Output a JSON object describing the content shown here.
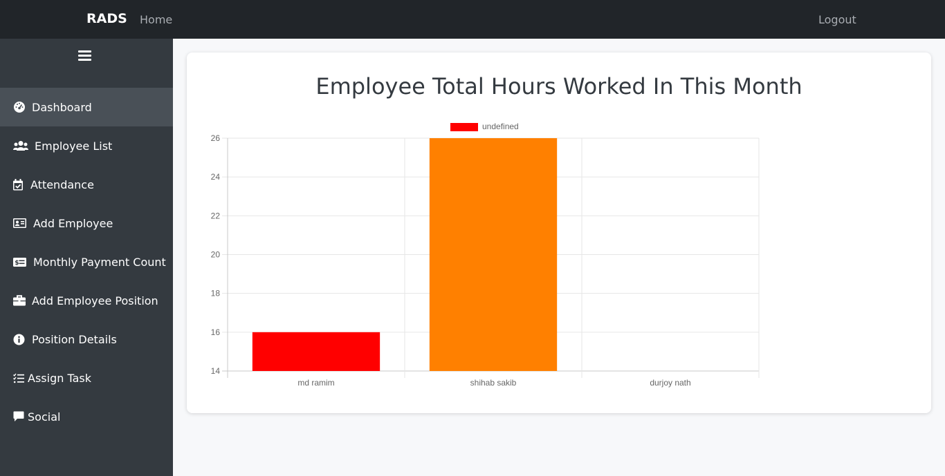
{
  "navbar": {
    "brand": "RADS",
    "home": "Home",
    "logout": "Logout"
  },
  "sidebar": {
    "items": [
      {
        "label": "Dashboard",
        "icon": "dashboard-icon",
        "active": true
      },
      {
        "label": "Employee List",
        "icon": "users-icon"
      },
      {
        "label": "Attendance",
        "icon": "calendar-check-icon"
      },
      {
        "label": "Add Employee",
        "icon": "id-card-icon"
      },
      {
        "label": "Monthly Payment Count",
        "icon": "money-bill-icon"
      },
      {
        "label": "Add Employee Position",
        "icon": "briefcase-icon"
      },
      {
        "label": "Position Details",
        "icon": "info-circle-icon"
      },
      {
        "label": "Assign Task",
        "icon": "task-list-icon"
      },
      {
        "label": "Social",
        "icon": "comment-icon"
      }
    ]
  },
  "main": {
    "title": "Employee Total Hours Worked In This Month"
  },
  "chart_data": {
    "type": "bar",
    "categories": [
      "md ramim",
      "shihab sakib",
      "durjoy nath"
    ],
    "series": [
      {
        "name": "undefined",
        "values": [
          16,
          26,
          14
        ],
        "colors": [
          "#ff0000",
          "#ff8000",
          "#ffff00"
        ]
      }
    ],
    "legend_color": "#ff0000",
    "ylim": [
      14,
      26
    ],
    "yticks": [
      14,
      16,
      18,
      20,
      22,
      24,
      26
    ],
    "grid": true,
    "legend_position": "top"
  }
}
